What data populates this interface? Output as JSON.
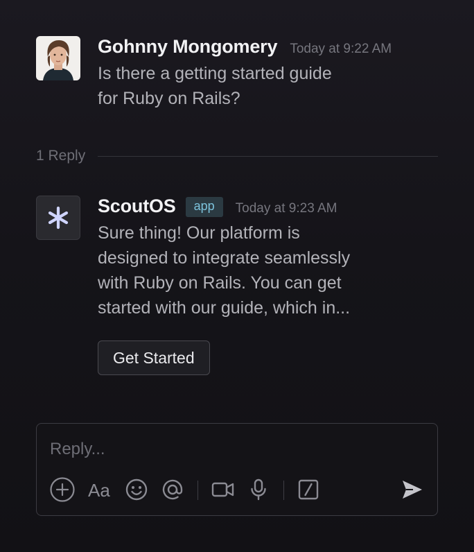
{
  "thread": {
    "question": {
      "author": "Gohnny Mongomery",
      "timestamp": "Today at 9:22 AM",
      "text": "Is there a getting started guide\nfor Ruby on Rails?"
    },
    "reply_count_label": "1 Reply",
    "reply": {
      "author": "ScoutOS",
      "badge": "app",
      "timestamp": "Today at 9:23 AM",
      "text": "Sure thing! Our platform is\ndesigned to integrate seamlessly\nwith Ruby on Rails. You can get\nstarted with our guide, which in...",
      "button_label": "Get Started"
    }
  },
  "composer": {
    "placeholder": "Reply...",
    "value": "",
    "tools": [
      "plus-circle-icon",
      "text-format-icon",
      "emoji-icon",
      "mention-icon",
      "video-icon",
      "microphone-icon",
      "slash-command-icon",
      "send-icon"
    ]
  },
  "colors": {
    "background": "#151419",
    "badge_bg": "#2b3a42",
    "badge_text": "#7cc3dc",
    "bot_icon": "#cfd4ff"
  }
}
